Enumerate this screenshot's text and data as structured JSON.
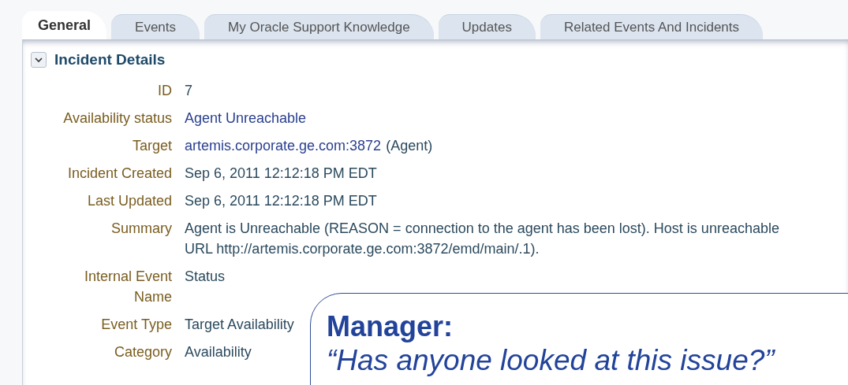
{
  "tabs": [
    {
      "label": "General",
      "selected": true
    },
    {
      "label": "Events",
      "selected": false
    },
    {
      "label": "My Oracle Support Knowledge",
      "selected": false
    },
    {
      "label": "Updates",
      "selected": false
    },
    {
      "label": "Related Events And Incidents",
      "selected": false
    }
  ],
  "section": {
    "title": "Incident Details",
    "expanded": true
  },
  "fields": [
    {
      "label": "ID",
      "value": "7",
      "kind": "text"
    },
    {
      "label": "Availability status",
      "value": "Agent Unreachable",
      "kind": "link"
    },
    {
      "label": "Target",
      "value": "artemis.corporate.ge.com:3872",
      "suffix": "(Agent)",
      "kind": "link"
    },
    {
      "label": "Incident Created",
      "value": "Sep 6, 2011 12:12:18 PM EDT",
      "kind": "text"
    },
    {
      "label": "Last Updated",
      "value": "Sep 6, 2011 12:12:18 PM EDT",
      "kind": "text"
    },
    {
      "label": "Summary",
      "value": "Agent is Unreachable (REASON = connection to the agent has been lost). Host is unreachable",
      "value_line_2": "URL http://artemis.corporate.ge.com:3872/emd/main/.1).",
      "kind": "text"
    },
    {
      "label": "Internal Event",
      "label_line_2": "Name",
      "value": "Status",
      "kind": "text"
    },
    {
      "label": "Event Type",
      "value": "Target Availability",
      "kind": "text"
    },
    {
      "label": "Category",
      "value": "Availability",
      "kind": "text"
    }
  ],
  "callout": {
    "speaker": "Manager:",
    "quote": "“Has anyone looked at this issue?”"
  }
}
